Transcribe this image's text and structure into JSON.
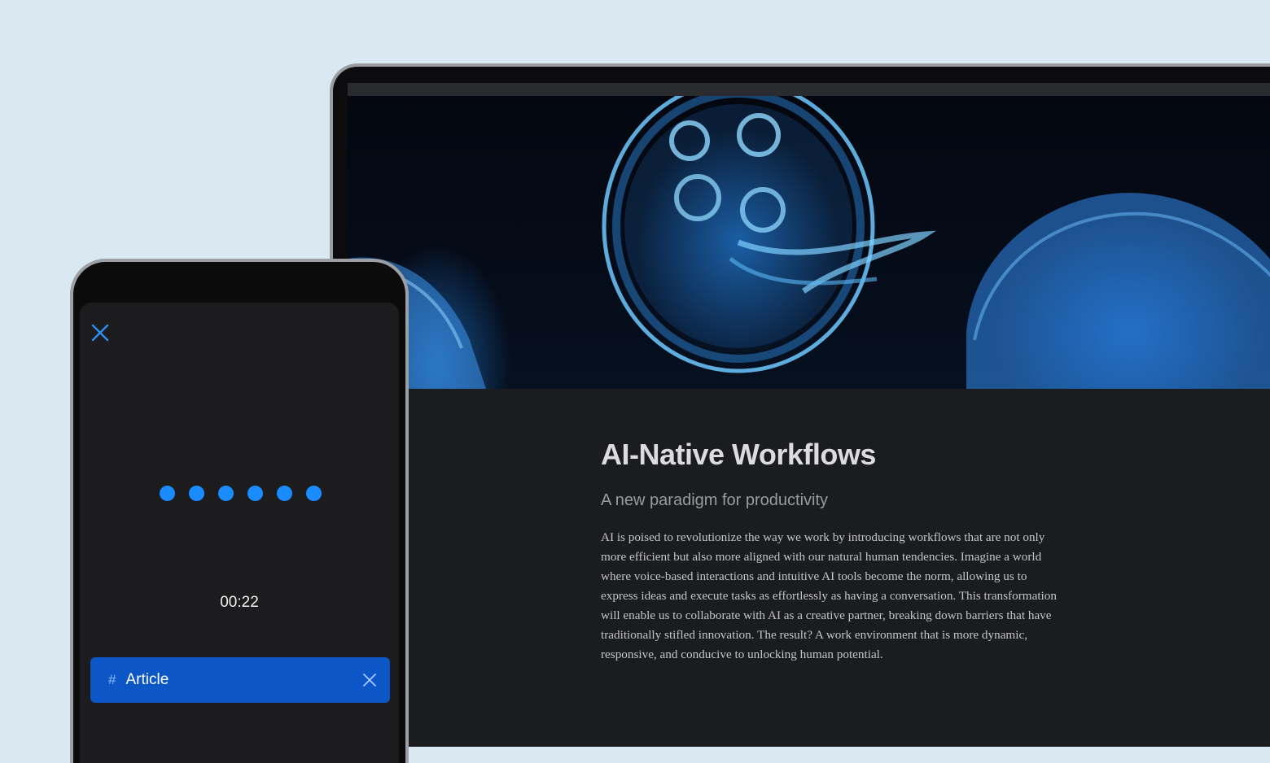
{
  "laptop": {
    "hero_image": "jellyfish-photo",
    "article": {
      "title": "AI-Native Workflows",
      "subtitle": "A new paradigm for productivity",
      "body": "AI is poised to revolutionize the way we work by introducing workflows that are not only more efficient but also more aligned with our natural human tendencies. Imagine a world where voice-based interactions and intuitive AI tools become the norm, allowing us to express ideas and execute tasks as effortlessly as having a conversation. This transformation will enable us to collaborate with AI as a creative partner, breaking down barriers that have traditionally stifled innovation. The result? A work environment that is more dynamic, responsive, and conducive to unlocking human potential."
    }
  },
  "phone": {
    "close_icon": "close-icon",
    "recording_indicator_dots": 6,
    "timer": "00:22",
    "chip": {
      "icon": "#",
      "label": "Article",
      "remove_icon": "close-icon"
    }
  },
  "colors": {
    "background": "#d9e8f1",
    "accent": "#1a8cff",
    "chip": "#0c56c8",
    "screen": "#1b1c20"
  }
}
